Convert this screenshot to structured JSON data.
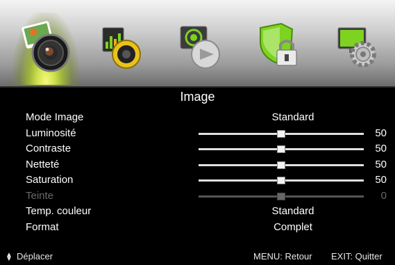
{
  "tabs": [
    {
      "name": "image-tab",
      "icon": "camera-photo-icon",
      "active": true
    },
    {
      "name": "sound-tab",
      "icon": "speaker-equalizer-icon",
      "active": false
    },
    {
      "name": "channel-tab",
      "icon": "satellite-dish-icon",
      "active": false
    },
    {
      "name": "lock-tab",
      "icon": "shield-lock-icon",
      "active": false
    },
    {
      "name": "settings-tab",
      "icon": "monitor-gear-icon",
      "active": false
    }
  ],
  "title": "Image",
  "rows": {
    "mode": {
      "label": "Mode Image",
      "value": "Standard"
    },
    "brightness": {
      "label": "Luminosité",
      "value": "50"
    },
    "contrast": {
      "label": "Contraste",
      "value": "50"
    },
    "sharpness": {
      "label": "Netteté",
      "value": "50"
    },
    "saturation": {
      "label": "Saturation",
      "value": "50"
    },
    "tint": {
      "label": "Teinte",
      "value": "0"
    },
    "color_temp": {
      "label": "Temp. couleur",
      "value": "Standard"
    },
    "format": {
      "label": "Format",
      "value": "Complet"
    }
  },
  "slider_levels": {
    "brightness": 0.5,
    "contrast": 0.5,
    "sharpness": 0.5,
    "saturation": 0.5,
    "tint": 0.5
  },
  "footer": {
    "move": "Déplacer",
    "menu": "MENU: Retour",
    "exit": "EXIT: Quitter"
  },
  "colors": {
    "active_glow": "#cfe24f",
    "disabled_text": "#6a6a6a"
  }
}
